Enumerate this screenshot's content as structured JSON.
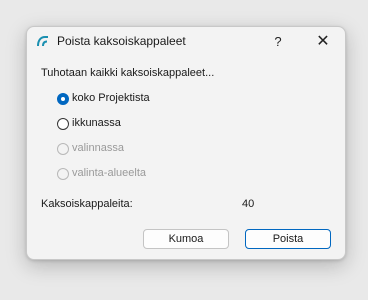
{
  "dialog": {
    "title": "Poista kaksoiskappaleet",
    "help_label": "?",
    "close_label": "✕",
    "heading": "Tuhotaan kaikki kaksoiskappaleet...",
    "options": [
      {
        "label": "koko Projektista",
        "checked": true,
        "disabled": false
      },
      {
        "label": "ikkunassa",
        "checked": false,
        "disabled": false
      },
      {
        "label": "valinnassa",
        "checked": false,
        "disabled": true
      },
      {
        "label": "valinta-alueelta",
        "checked": false,
        "disabled": true
      }
    ],
    "count_label": "Kaksoiskappaleita:",
    "count_value": "40",
    "cancel_label": "Kumoa",
    "confirm_label": "Poista"
  },
  "colors": {
    "accent": "#0067c0",
    "app_icon": "#1a8fb0"
  }
}
